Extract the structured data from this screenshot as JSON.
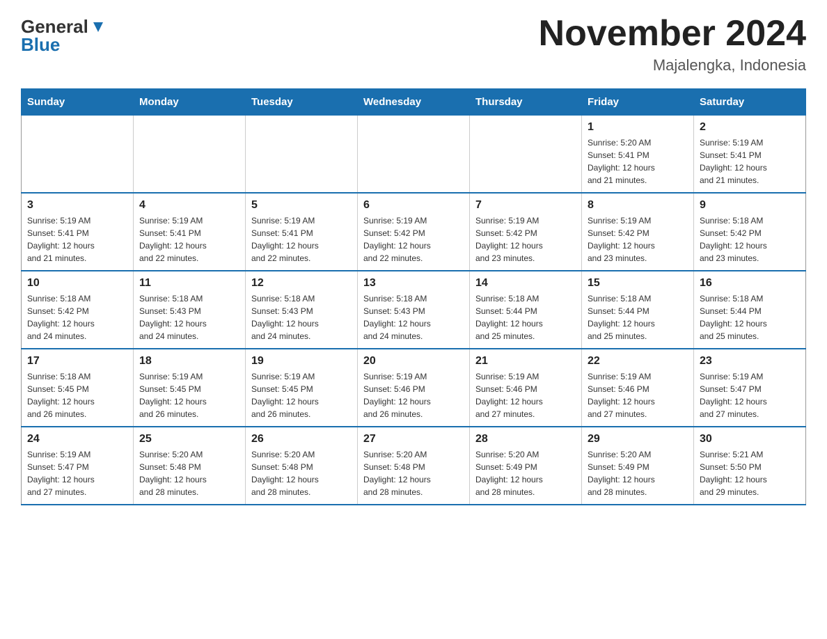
{
  "header": {
    "logo_general": "General",
    "logo_blue": "Blue",
    "month_title": "November 2024",
    "location": "Majalengka, Indonesia"
  },
  "weekdays": [
    "Sunday",
    "Monday",
    "Tuesday",
    "Wednesday",
    "Thursday",
    "Friday",
    "Saturday"
  ],
  "weeks": [
    [
      {
        "day": "",
        "info": ""
      },
      {
        "day": "",
        "info": ""
      },
      {
        "day": "",
        "info": ""
      },
      {
        "day": "",
        "info": ""
      },
      {
        "day": "",
        "info": ""
      },
      {
        "day": "1",
        "info": "Sunrise: 5:20 AM\nSunset: 5:41 PM\nDaylight: 12 hours\nand 21 minutes."
      },
      {
        "day": "2",
        "info": "Sunrise: 5:19 AM\nSunset: 5:41 PM\nDaylight: 12 hours\nand 21 minutes."
      }
    ],
    [
      {
        "day": "3",
        "info": "Sunrise: 5:19 AM\nSunset: 5:41 PM\nDaylight: 12 hours\nand 21 minutes."
      },
      {
        "day": "4",
        "info": "Sunrise: 5:19 AM\nSunset: 5:41 PM\nDaylight: 12 hours\nand 22 minutes."
      },
      {
        "day": "5",
        "info": "Sunrise: 5:19 AM\nSunset: 5:41 PM\nDaylight: 12 hours\nand 22 minutes."
      },
      {
        "day": "6",
        "info": "Sunrise: 5:19 AM\nSunset: 5:42 PM\nDaylight: 12 hours\nand 22 minutes."
      },
      {
        "day": "7",
        "info": "Sunrise: 5:19 AM\nSunset: 5:42 PM\nDaylight: 12 hours\nand 23 minutes."
      },
      {
        "day": "8",
        "info": "Sunrise: 5:19 AM\nSunset: 5:42 PM\nDaylight: 12 hours\nand 23 minutes."
      },
      {
        "day": "9",
        "info": "Sunrise: 5:18 AM\nSunset: 5:42 PM\nDaylight: 12 hours\nand 23 minutes."
      }
    ],
    [
      {
        "day": "10",
        "info": "Sunrise: 5:18 AM\nSunset: 5:42 PM\nDaylight: 12 hours\nand 24 minutes."
      },
      {
        "day": "11",
        "info": "Sunrise: 5:18 AM\nSunset: 5:43 PM\nDaylight: 12 hours\nand 24 minutes."
      },
      {
        "day": "12",
        "info": "Sunrise: 5:18 AM\nSunset: 5:43 PM\nDaylight: 12 hours\nand 24 minutes."
      },
      {
        "day": "13",
        "info": "Sunrise: 5:18 AM\nSunset: 5:43 PM\nDaylight: 12 hours\nand 24 minutes."
      },
      {
        "day": "14",
        "info": "Sunrise: 5:18 AM\nSunset: 5:44 PM\nDaylight: 12 hours\nand 25 minutes."
      },
      {
        "day": "15",
        "info": "Sunrise: 5:18 AM\nSunset: 5:44 PM\nDaylight: 12 hours\nand 25 minutes."
      },
      {
        "day": "16",
        "info": "Sunrise: 5:18 AM\nSunset: 5:44 PM\nDaylight: 12 hours\nand 25 minutes."
      }
    ],
    [
      {
        "day": "17",
        "info": "Sunrise: 5:18 AM\nSunset: 5:45 PM\nDaylight: 12 hours\nand 26 minutes."
      },
      {
        "day": "18",
        "info": "Sunrise: 5:19 AM\nSunset: 5:45 PM\nDaylight: 12 hours\nand 26 minutes."
      },
      {
        "day": "19",
        "info": "Sunrise: 5:19 AM\nSunset: 5:45 PM\nDaylight: 12 hours\nand 26 minutes."
      },
      {
        "day": "20",
        "info": "Sunrise: 5:19 AM\nSunset: 5:46 PM\nDaylight: 12 hours\nand 26 minutes."
      },
      {
        "day": "21",
        "info": "Sunrise: 5:19 AM\nSunset: 5:46 PM\nDaylight: 12 hours\nand 27 minutes."
      },
      {
        "day": "22",
        "info": "Sunrise: 5:19 AM\nSunset: 5:46 PM\nDaylight: 12 hours\nand 27 minutes."
      },
      {
        "day": "23",
        "info": "Sunrise: 5:19 AM\nSunset: 5:47 PM\nDaylight: 12 hours\nand 27 minutes."
      }
    ],
    [
      {
        "day": "24",
        "info": "Sunrise: 5:19 AM\nSunset: 5:47 PM\nDaylight: 12 hours\nand 27 minutes."
      },
      {
        "day": "25",
        "info": "Sunrise: 5:20 AM\nSunset: 5:48 PM\nDaylight: 12 hours\nand 28 minutes."
      },
      {
        "day": "26",
        "info": "Sunrise: 5:20 AM\nSunset: 5:48 PM\nDaylight: 12 hours\nand 28 minutes."
      },
      {
        "day": "27",
        "info": "Sunrise: 5:20 AM\nSunset: 5:48 PM\nDaylight: 12 hours\nand 28 minutes."
      },
      {
        "day": "28",
        "info": "Sunrise: 5:20 AM\nSunset: 5:49 PM\nDaylight: 12 hours\nand 28 minutes."
      },
      {
        "day": "29",
        "info": "Sunrise: 5:20 AM\nSunset: 5:49 PM\nDaylight: 12 hours\nand 28 minutes."
      },
      {
        "day": "30",
        "info": "Sunrise: 5:21 AM\nSunset: 5:50 PM\nDaylight: 12 hours\nand 29 minutes."
      }
    ]
  ]
}
